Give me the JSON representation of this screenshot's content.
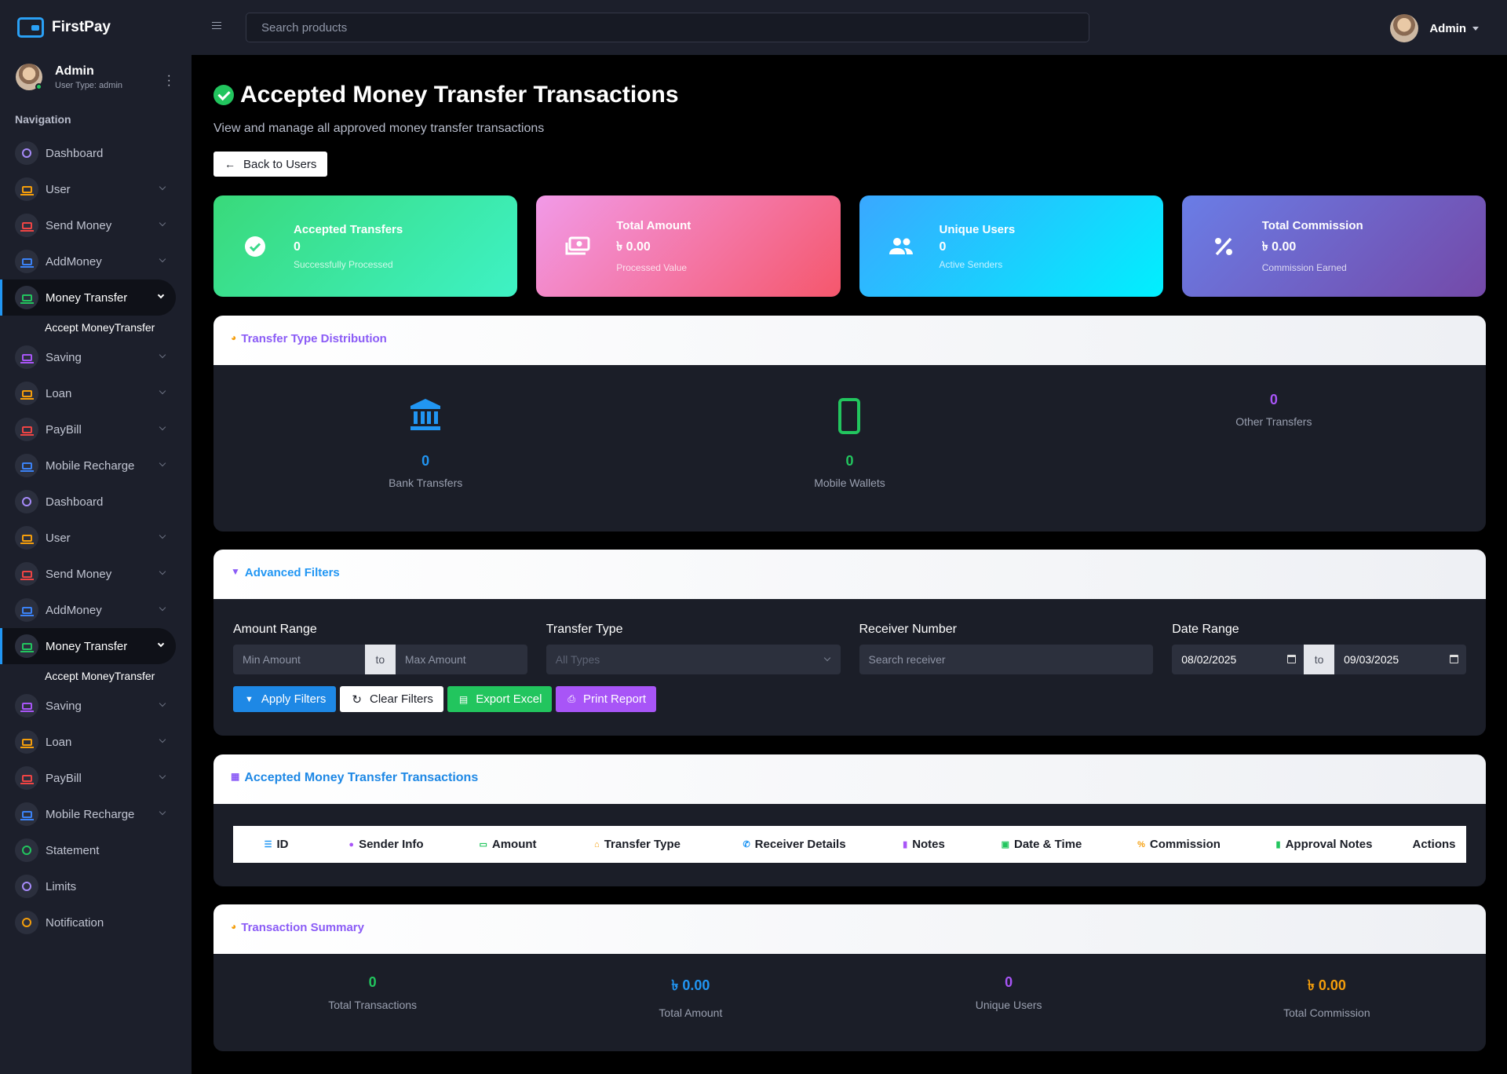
{
  "app": {
    "name": "FirstPay"
  },
  "profile": {
    "name": "Admin",
    "user_type": "User Type: admin"
  },
  "nav": {
    "heading": "Navigation",
    "items": [
      {
        "label": "Dashboard",
        "icon": "gauge-icon",
        "color": "#a78bfa",
        "chevron": false
      },
      {
        "label": "User",
        "icon": "laptop-icon",
        "color": "#f59e0b",
        "chevron": true
      },
      {
        "label": "Send Money",
        "icon": "laptop-icon",
        "color": "#ef4444",
        "chevron": true
      },
      {
        "label": "AddMoney",
        "icon": "laptop-icon",
        "color": "#3b82f6",
        "chevron": true
      },
      {
        "label": "Money Transfer",
        "icon": "laptop-icon",
        "color": "#22c55e",
        "chevron": true,
        "active": true,
        "sub": "Accept MoneyTransfer"
      },
      {
        "label": "Saving",
        "icon": "laptop-icon",
        "color": "#a855f7",
        "chevron": true
      },
      {
        "label": "Loan",
        "icon": "laptop-icon",
        "color": "#f59e0b",
        "chevron": true
      },
      {
        "label": "PayBill",
        "icon": "laptop-icon",
        "color": "#ef4444",
        "chevron": true
      },
      {
        "label": "Mobile Recharge",
        "icon": "laptop-icon",
        "color": "#3b82f6",
        "chevron": true
      },
      {
        "label": "Dashboard",
        "icon": "gauge-icon",
        "color": "#a78bfa",
        "chevron": false
      },
      {
        "label": "User",
        "icon": "laptop-icon",
        "color": "#f59e0b",
        "chevron": true
      },
      {
        "label": "Send Money",
        "icon": "laptop-icon",
        "color": "#ef4444",
        "chevron": true
      },
      {
        "label": "AddMoney",
        "icon": "laptop-icon",
        "color": "#3b82f6",
        "chevron": true
      },
      {
        "label": "Money Transfer",
        "icon": "laptop-icon",
        "color": "#22c55e",
        "chevron": true,
        "active": true,
        "sub": "Accept MoneyTransfer"
      },
      {
        "label": "Saving",
        "icon": "laptop-icon",
        "color": "#a855f7",
        "chevron": true
      },
      {
        "label": "Loan",
        "icon": "laptop-icon",
        "color": "#f59e0b",
        "chevron": true
      },
      {
        "label": "PayBill",
        "icon": "laptop-icon",
        "color": "#ef4444",
        "chevron": true
      },
      {
        "label": "Mobile Recharge",
        "icon": "laptop-icon",
        "color": "#3b82f6",
        "chevron": true
      },
      {
        "label": "Statement",
        "icon": "gauge-icon",
        "color": "#22c55e",
        "chevron": false
      },
      {
        "label": "Limits",
        "icon": "gauge-icon",
        "color": "#a78bfa",
        "chevron": false
      },
      {
        "label": "Notification",
        "icon": "gauge-icon",
        "color": "#f59e0b",
        "chevron": false
      }
    ]
  },
  "topbar": {
    "search_placeholder": "Search products",
    "user_name": "Admin"
  },
  "page": {
    "title": "Accepted Money Transfer Transactions",
    "subtitle": "View and manage all approved money transfer transactions",
    "back_label": "Back to Users"
  },
  "stats": [
    {
      "title": "Accepted Transfers",
      "value": "0",
      "caption": "Successfully Processed",
      "icon": "check-circle-icon"
    },
    {
      "title": "Total Amount",
      "value": "৳ 0.00",
      "caption": "Processed Value",
      "icon": "money-icon"
    },
    {
      "title": "Unique Users",
      "value": "0",
      "caption": "Active Senders",
      "icon": "users-icon"
    },
    {
      "title": "Total Commission",
      "value": "৳ 0.00",
      "caption": "Commission Earned",
      "icon": "percent-icon"
    }
  ],
  "distribution": {
    "title": "Transfer Type Distribution",
    "items": [
      {
        "value": "0",
        "label": "Bank Transfers",
        "color": "#2196f3",
        "icon": "bank-icon"
      },
      {
        "value": "0",
        "label": "Mobile Wallets",
        "color": "#22c55e",
        "icon": "mobile-icon"
      },
      {
        "value": "0",
        "label": "Other Transfers",
        "color": "#a855f7",
        "icon": ""
      }
    ]
  },
  "filters": {
    "title": "Advanced Filters",
    "amount_label": "Amount Range",
    "min_placeholder": "Min Amount",
    "max_placeholder": "Max Amount",
    "to": "to",
    "type_label": "Transfer Type",
    "type_value": "All Types",
    "receiver_label": "Receiver Number",
    "receiver_placeholder": "Search receiver",
    "date_label": "Date Range",
    "date_from": "08/02/2025",
    "date_to": "09/03/2025",
    "buttons": {
      "apply": "Apply Filters",
      "clear": "Clear Filters",
      "export": "Export Excel",
      "print": "Print Report"
    }
  },
  "table": {
    "title": "Accepted Money Transfer Transactions",
    "columns": [
      {
        "label": "ID",
        "icon": "list-icon",
        "color": "#2196f3"
      },
      {
        "label": "Sender Info",
        "icon": "user-icon",
        "color": "#a855f7"
      },
      {
        "label": "Amount",
        "icon": "money-icon",
        "color": "#22c55e"
      },
      {
        "label": "Transfer Type",
        "icon": "bank-icon",
        "color": "#f59e0b"
      },
      {
        "label": "Receiver Details",
        "icon": "phone-icon",
        "color": "#2196f3"
      },
      {
        "label": "Notes",
        "icon": "note-icon",
        "color": "#a855f7"
      },
      {
        "label": "Date & Time",
        "icon": "calendar-icon",
        "color": "#22c55e"
      },
      {
        "label": "Commission",
        "icon": "percent-icon",
        "color": "#f59e0b"
      },
      {
        "label": "Approval Notes",
        "icon": "note-icon",
        "color": "#22c55e"
      },
      {
        "label": "Actions",
        "icon": "",
        "color": ""
      }
    ]
  },
  "summary": {
    "title": "Transaction Summary",
    "items": [
      {
        "value": "0",
        "label": "Total Transactions",
        "color": "#22c55e"
      },
      {
        "value": "৳ 0.00",
        "label": "Total Amount",
        "color": "#2196f3"
      },
      {
        "value": "0",
        "label": "Unique Users",
        "color": "#a855f7"
      },
      {
        "value": "৳ 0.00",
        "label": "Total Commission",
        "color": "#f59e0b"
      }
    ]
  }
}
